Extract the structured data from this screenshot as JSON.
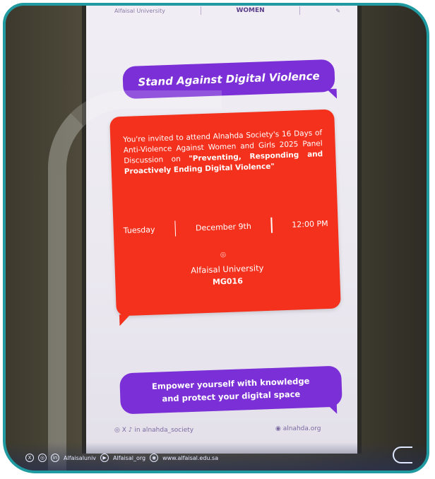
{
  "top_logos": {
    "left": "Alfaisal University",
    "center": "WOMEN",
    "right": ""
  },
  "headline": "Stand Against Digital Violence",
  "invite": {
    "line1": "You're invited to attend Alnahda Society's 16 Days of Anti-Violence Against Women and Girls 2025 Panel Discussion on",
    "title": "\"Preventing, Responding and Proactively Ending Digital Violence\""
  },
  "meta": {
    "day": "Tuesday",
    "date": "December 9th",
    "time": "12:00 PM"
  },
  "venue": {
    "pin_icon": "location-pin-icon",
    "name": "Alfaisal University",
    "room": "MG016"
  },
  "tagline": {
    "line1": "Empower yourself with knowledge",
    "line2": "and protect your digital space"
  },
  "footer": {
    "social": "alnahda_society",
    "site": "alnahda.org"
  },
  "strip": {
    "handle1": "Alfaisaluniv",
    "handle2": "Alfaisal_org",
    "site": "www.alfaisal.edu.sa"
  },
  "colors": {
    "frame": "#1f9aa0",
    "purple": "#7b2fd6",
    "red": "#f3311d"
  }
}
